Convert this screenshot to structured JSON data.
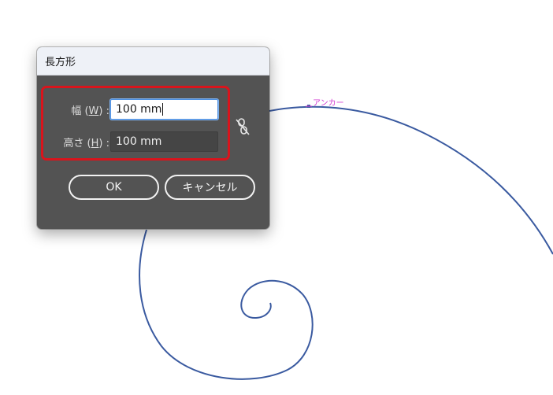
{
  "canvas": {
    "anchor_label": "アンカー",
    "spiral_color": "#3a5aa0",
    "anchor_label_color": "#d23cd2"
  },
  "dialog": {
    "title": "長方形",
    "width_field": {
      "label_prefix": "幅 (",
      "label_key": "W",
      "label_suffix": ") :",
      "value": "100 mm",
      "focused": true
    },
    "height_field": {
      "label_prefix": "高さ (",
      "label_key": "H",
      "label_suffix": ") :",
      "value": "100 mm",
      "focused": false
    },
    "link_icon": "unlink-chain-icon",
    "highlight_color": "#d9141c",
    "buttons": {
      "ok_label": "OK",
      "cancel_label": "キャンセル"
    }
  }
}
